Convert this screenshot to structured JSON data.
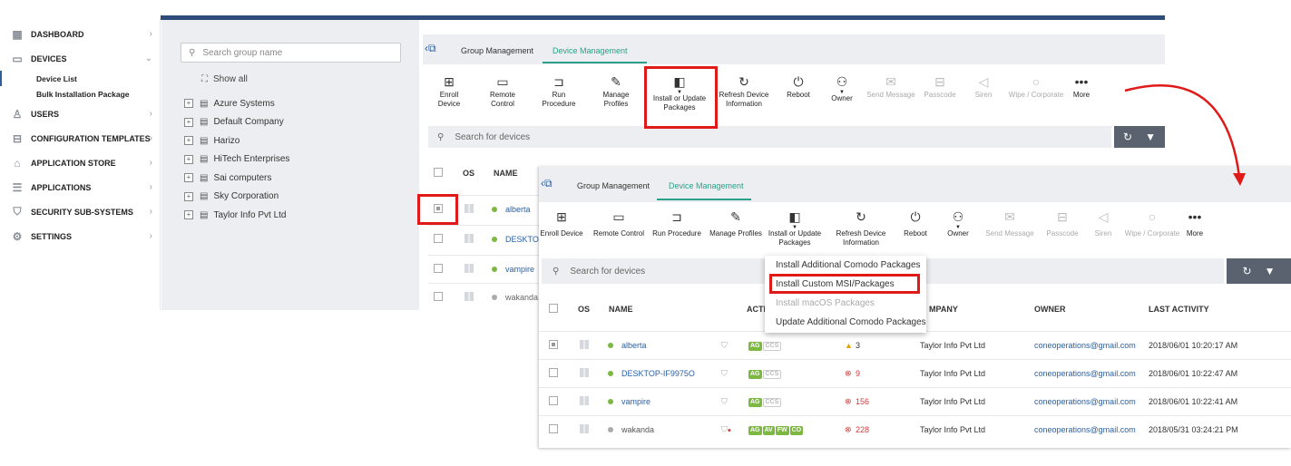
{
  "sidebar": {
    "items": [
      {
        "label": "DASHBOARD",
        "icon": "dashboard-icon"
      },
      {
        "label": "DEVICES",
        "icon": "devices-icon"
      },
      {
        "label": "USERS",
        "icon": "users-icon"
      },
      {
        "label": "CONFIGURATION TEMPLATES",
        "icon": "templates-icon"
      },
      {
        "label": "APPLICATION STORE",
        "icon": "store-icon"
      },
      {
        "label": "APPLICATIONS",
        "icon": "applications-icon"
      },
      {
        "label": "SECURITY SUB-SYSTEMS",
        "icon": "shield-icon"
      },
      {
        "label": "SETTINGS",
        "icon": "gear-icon"
      }
    ],
    "sub_items": [
      "Device List",
      "Bulk Installation Package"
    ]
  },
  "groups": {
    "search_placeholder": "Search group name",
    "show_all": "Show all",
    "list": [
      "Azure Systems",
      "Default Company",
      "Harizo",
      "HiTech Enterprises",
      "Sai computers",
      "Sky Corporation",
      "Taylor Info Pvt Ltd"
    ]
  },
  "tabs": [
    "Group Management",
    "Device Management"
  ],
  "toolbar": {
    "enroll": "Enroll Device",
    "remote": "Remote Control",
    "run": "Run Procedure",
    "manage": "Manage Profiles",
    "install_1": "Install or Update",
    "install_2": "Packages",
    "refresh_1": "Refresh Device",
    "refresh_2": "Information",
    "reboot": "Reboot",
    "owner": "Owner",
    "send": "Send Message",
    "passcode": "Passcode",
    "siren": "Siren",
    "wipe": "Wipe / Corporate",
    "more": "More"
  },
  "device_search_placeholder": "Search for devices",
  "table": {
    "headers": {
      "os": "OS",
      "name": "NAME",
      "company": "MPANY",
      "owner": "OWNER",
      "last_activity": "LAST ACTIVITY",
      "active_partial": "ACTI"
    },
    "rows": [
      {
        "name": "alberta",
        "status_count": "3",
        "company": "Taylor Info Pvt Ltd",
        "owner": "coneoperations@gmail.com",
        "last": "2018/06/01 10:20:17 AM"
      },
      {
        "name": "DESKTOP-IF9975O",
        "status_count": "9",
        "company": "Taylor Info Pvt Ltd",
        "owner": "coneoperations@gmail.com",
        "last": "2018/06/01 10:22:47 AM"
      },
      {
        "name": "vampire",
        "status_count": "156",
        "company": "Taylor Info Pvt Ltd",
        "owner": "coneoperations@gmail.com",
        "last": "2018/06/01 10:22:41 AM"
      },
      {
        "name": "wakanda",
        "status_count": "228",
        "company": "Taylor Info Pvt Ltd",
        "owner": "coneoperations@gmail.com",
        "last": "2018/05/31 03:24:21 PM"
      }
    ],
    "bg_names": [
      "alberta",
      "DESKTOP-",
      "vampire",
      "wakanda"
    ],
    "badges": {
      "ag": "AG",
      "ccs": "CCS",
      "av": "AV",
      "fw": "FW",
      "co": "CO"
    }
  },
  "dropdown": {
    "items": [
      "Install Additional Comodo Packages",
      "Install Custom MSI/Packages",
      "Install macOS Packages",
      "Update Additional Comodo Packages"
    ]
  },
  "colors": {
    "accent": "#2aa08a",
    "highlight": "#e01919",
    "link": "#2b5f9e",
    "topbar": "#2e4d7b"
  }
}
